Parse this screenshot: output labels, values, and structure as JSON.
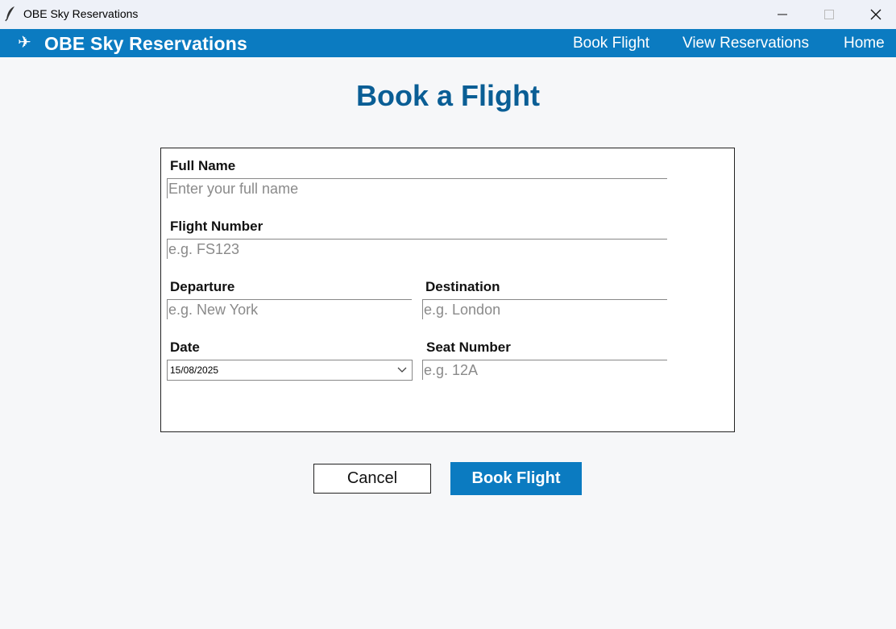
{
  "window": {
    "title": "OBE Sky Reservations",
    "app_icon": "feather-icon"
  },
  "navbar": {
    "brand_icon": "✈",
    "brand": "OBE Sky Reservations",
    "links": {
      "book_flight": "Book Flight",
      "view_reservations": "View Reservations",
      "home": "Home"
    },
    "color": "#0b7bc1"
  },
  "page": {
    "title": "Book a Flight",
    "title_color": "#0a5e95"
  },
  "form": {
    "full_name": {
      "label": "Full Name",
      "value": "",
      "placeholder": "Enter your full name"
    },
    "flight_number": {
      "label": "Flight Number",
      "value": "",
      "placeholder": "e.g. FS123"
    },
    "departure": {
      "label": "Departure",
      "value": "",
      "placeholder": "e.g. New York"
    },
    "destination": {
      "label": "Destination",
      "value": "",
      "placeholder": "e.g. London"
    },
    "date": {
      "label": "Date",
      "value": "15/08/2025"
    },
    "seat_number": {
      "label": "Seat Number",
      "value": "",
      "placeholder": "e.g. 12A"
    }
  },
  "actions": {
    "cancel": "Cancel",
    "book": "Book Flight"
  }
}
